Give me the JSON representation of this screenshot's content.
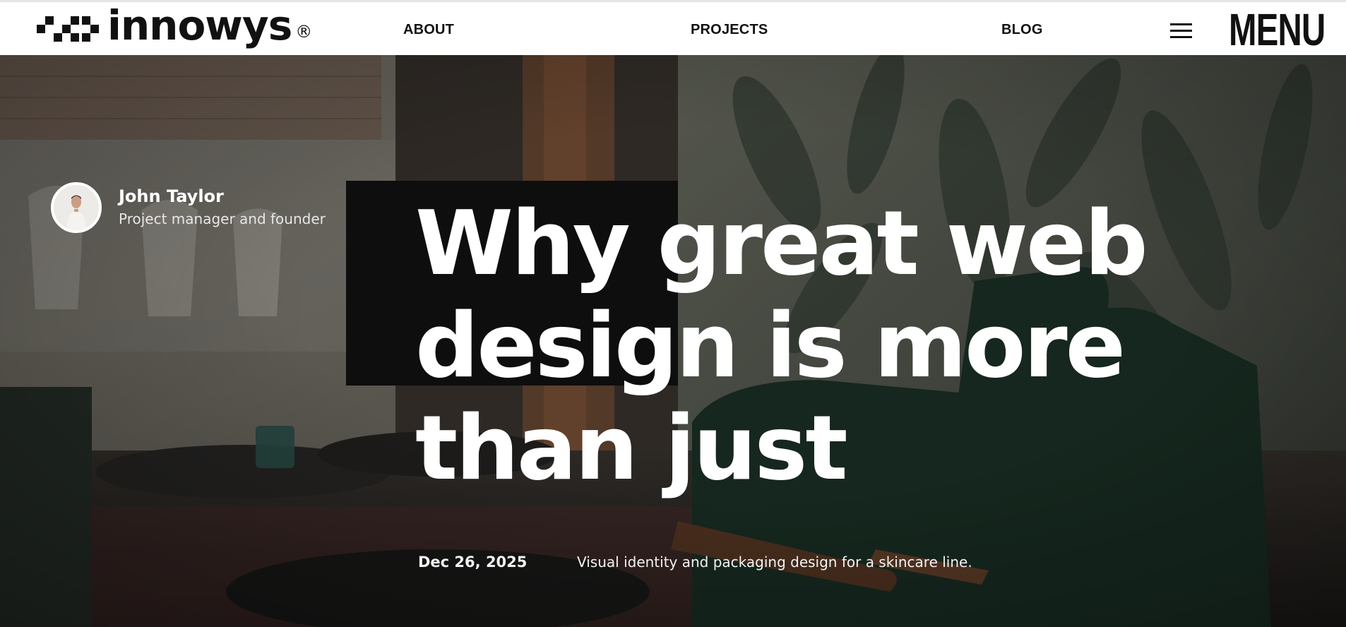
{
  "header": {
    "logo_text": "innowys",
    "logo_registered": "®",
    "nav": {
      "about": "ABOUT",
      "projects": "PROJECTS",
      "blog": "BLOG"
    },
    "menu_icon": "hamburger-icon",
    "menu_label": "MENU"
  },
  "author": {
    "name": "John Taylor",
    "role": "Project manager and founder"
  },
  "post": {
    "title": "Why great web design is more than just",
    "date": "Dec 26, 2025",
    "description": "Visual identity and packaging design for a skincare line."
  },
  "colors": {
    "header_bg": "#ffffff",
    "text_dark": "#111111",
    "hero_text": "#ffffff"
  }
}
